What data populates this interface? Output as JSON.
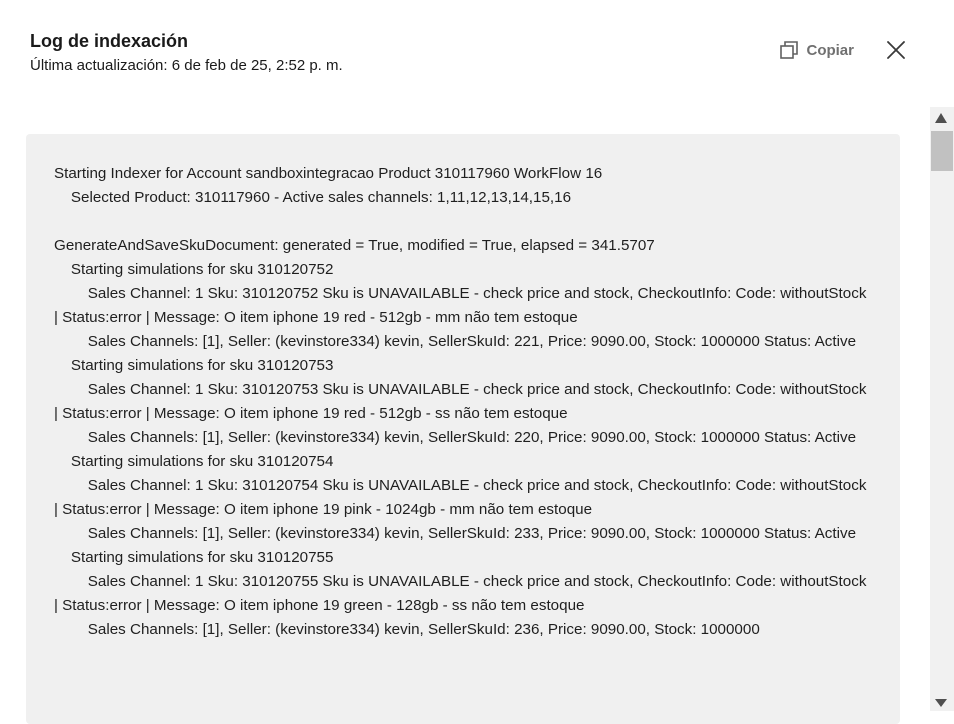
{
  "dialog": {
    "title": "Log de indexación",
    "subtitle": "Última actualización: 6 de feb de 25, 2:52 p. m.",
    "copy_label": "Copiar",
    "copy_icon": "copy-icon",
    "close_icon": "close-icon"
  },
  "log": {
    "lines": [
      "Starting Indexer for Account sandboxintegracao Product 310117960 WorkFlow 16",
      "    Selected Product: 310117960 - Active sales channels: 1,11,12,13,14,15,16",
      "",
      "GenerateAndSaveSkuDocument: generated = True, modified = True, elapsed = 341.5707",
      "    Starting simulations for sku 310120752",
      "        Sales Channel: 1 Sku: 310120752 Sku is UNAVAILABLE - check price and stock, CheckoutInfo: Code: withoutStock | Status:error | Message: O item iphone 19 red - 512gb - mm não tem estoque",
      "        Sales Channels: [1], Seller: (kevinstore334) kevin, SellerSkuId: 221, Price: 9090.00, Stock: 1000000 Status: Active",
      "    Starting simulations for sku 310120753",
      "        Sales Channel: 1 Sku: 310120753 Sku is UNAVAILABLE - check price and stock, CheckoutInfo: Code: withoutStock | Status:error | Message: O item iphone 19 red - 512gb - ss não tem estoque",
      "        Sales Channels: [1], Seller: (kevinstore334) kevin, SellerSkuId: 220, Price: 9090.00, Stock: 1000000 Status: Active",
      "    Starting simulations for sku 310120754",
      "        Sales Channel: 1 Sku: 310120754 Sku is UNAVAILABLE - check price and stock, CheckoutInfo: Code: withoutStock | Status:error | Message: O item iphone 19 pink - 1024gb - mm não tem estoque",
      "        Sales Channels: [1], Seller: (kevinstore334) kevin, SellerSkuId: 233, Price: 9090.00, Stock: 1000000 Status: Active",
      "    Starting simulations for sku 310120755",
      "        Sales Channel: 1 Sku: 310120755 Sku is UNAVAILABLE - check price and stock, CheckoutInfo: Code: withoutStock | Status:error | Message: O item iphone 19 green - 128gb - ss não tem estoque",
      "        Sales Channels: [1], Seller: (kevinstore334) kevin, SellerSkuId: 236, Price: 9090.00, Stock: 1000000"
    ]
  }
}
